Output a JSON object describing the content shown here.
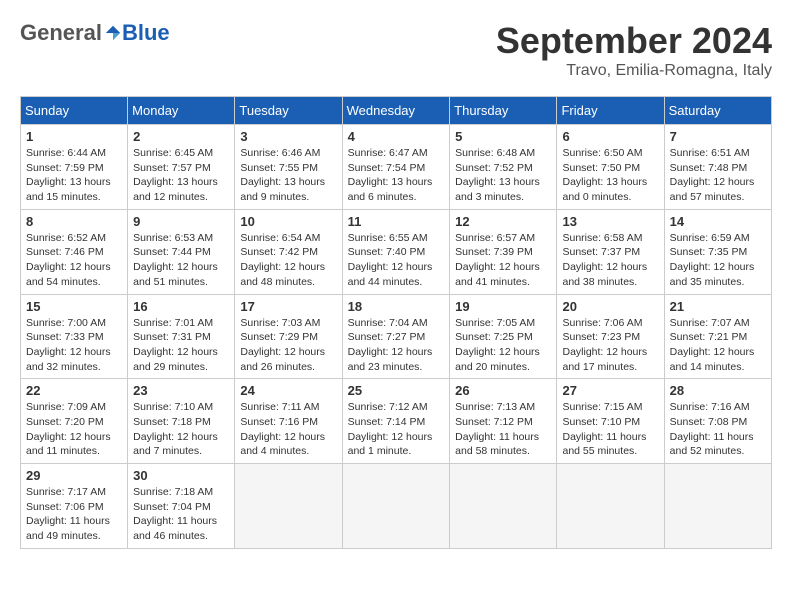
{
  "logo": {
    "general": "General",
    "blue": "Blue"
  },
  "header": {
    "month": "September 2024",
    "location": "Travo, Emilia-Romagna, Italy"
  },
  "weekdays": [
    "Sunday",
    "Monday",
    "Tuesday",
    "Wednesday",
    "Thursday",
    "Friday",
    "Saturday"
  ],
  "weeks": [
    [
      {
        "day": "1",
        "info": "Sunrise: 6:44 AM\nSunset: 7:59 PM\nDaylight: 13 hours\nand 15 minutes."
      },
      {
        "day": "2",
        "info": "Sunrise: 6:45 AM\nSunset: 7:57 PM\nDaylight: 13 hours\nand 12 minutes."
      },
      {
        "day": "3",
        "info": "Sunrise: 6:46 AM\nSunset: 7:55 PM\nDaylight: 13 hours\nand 9 minutes."
      },
      {
        "day": "4",
        "info": "Sunrise: 6:47 AM\nSunset: 7:54 PM\nDaylight: 13 hours\nand 6 minutes."
      },
      {
        "day": "5",
        "info": "Sunrise: 6:48 AM\nSunset: 7:52 PM\nDaylight: 13 hours\nand 3 minutes."
      },
      {
        "day": "6",
        "info": "Sunrise: 6:50 AM\nSunset: 7:50 PM\nDaylight: 13 hours\nand 0 minutes."
      },
      {
        "day": "7",
        "info": "Sunrise: 6:51 AM\nSunset: 7:48 PM\nDaylight: 12 hours\nand 57 minutes."
      }
    ],
    [
      {
        "day": "8",
        "info": "Sunrise: 6:52 AM\nSunset: 7:46 PM\nDaylight: 12 hours\nand 54 minutes."
      },
      {
        "day": "9",
        "info": "Sunrise: 6:53 AM\nSunset: 7:44 PM\nDaylight: 12 hours\nand 51 minutes."
      },
      {
        "day": "10",
        "info": "Sunrise: 6:54 AM\nSunset: 7:42 PM\nDaylight: 12 hours\nand 48 minutes."
      },
      {
        "day": "11",
        "info": "Sunrise: 6:55 AM\nSunset: 7:40 PM\nDaylight: 12 hours\nand 44 minutes."
      },
      {
        "day": "12",
        "info": "Sunrise: 6:57 AM\nSunset: 7:39 PM\nDaylight: 12 hours\nand 41 minutes."
      },
      {
        "day": "13",
        "info": "Sunrise: 6:58 AM\nSunset: 7:37 PM\nDaylight: 12 hours\nand 38 minutes."
      },
      {
        "day": "14",
        "info": "Sunrise: 6:59 AM\nSunset: 7:35 PM\nDaylight: 12 hours\nand 35 minutes."
      }
    ],
    [
      {
        "day": "15",
        "info": "Sunrise: 7:00 AM\nSunset: 7:33 PM\nDaylight: 12 hours\nand 32 minutes."
      },
      {
        "day": "16",
        "info": "Sunrise: 7:01 AM\nSunset: 7:31 PM\nDaylight: 12 hours\nand 29 minutes."
      },
      {
        "day": "17",
        "info": "Sunrise: 7:03 AM\nSunset: 7:29 PM\nDaylight: 12 hours\nand 26 minutes."
      },
      {
        "day": "18",
        "info": "Sunrise: 7:04 AM\nSunset: 7:27 PM\nDaylight: 12 hours\nand 23 minutes."
      },
      {
        "day": "19",
        "info": "Sunrise: 7:05 AM\nSunset: 7:25 PM\nDaylight: 12 hours\nand 20 minutes."
      },
      {
        "day": "20",
        "info": "Sunrise: 7:06 AM\nSunset: 7:23 PM\nDaylight: 12 hours\nand 17 minutes."
      },
      {
        "day": "21",
        "info": "Sunrise: 7:07 AM\nSunset: 7:21 PM\nDaylight: 12 hours\nand 14 minutes."
      }
    ],
    [
      {
        "day": "22",
        "info": "Sunrise: 7:09 AM\nSunset: 7:20 PM\nDaylight: 12 hours\nand 11 minutes."
      },
      {
        "day": "23",
        "info": "Sunrise: 7:10 AM\nSunset: 7:18 PM\nDaylight: 12 hours\nand 7 minutes."
      },
      {
        "day": "24",
        "info": "Sunrise: 7:11 AM\nSunset: 7:16 PM\nDaylight: 12 hours\nand 4 minutes."
      },
      {
        "day": "25",
        "info": "Sunrise: 7:12 AM\nSunset: 7:14 PM\nDaylight: 12 hours\nand 1 minute."
      },
      {
        "day": "26",
        "info": "Sunrise: 7:13 AM\nSunset: 7:12 PM\nDaylight: 11 hours\nand 58 minutes."
      },
      {
        "day": "27",
        "info": "Sunrise: 7:15 AM\nSunset: 7:10 PM\nDaylight: 11 hours\nand 55 minutes."
      },
      {
        "day": "28",
        "info": "Sunrise: 7:16 AM\nSunset: 7:08 PM\nDaylight: 11 hours\nand 52 minutes."
      }
    ],
    [
      {
        "day": "29",
        "info": "Sunrise: 7:17 AM\nSunset: 7:06 PM\nDaylight: 11 hours\nand 49 minutes."
      },
      {
        "day": "30",
        "info": "Sunrise: 7:18 AM\nSunset: 7:04 PM\nDaylight: 11 hours\nand 46 minutes."
      },
      null,
      null,
      null,
      null,
      null
    ]
  ]
}
